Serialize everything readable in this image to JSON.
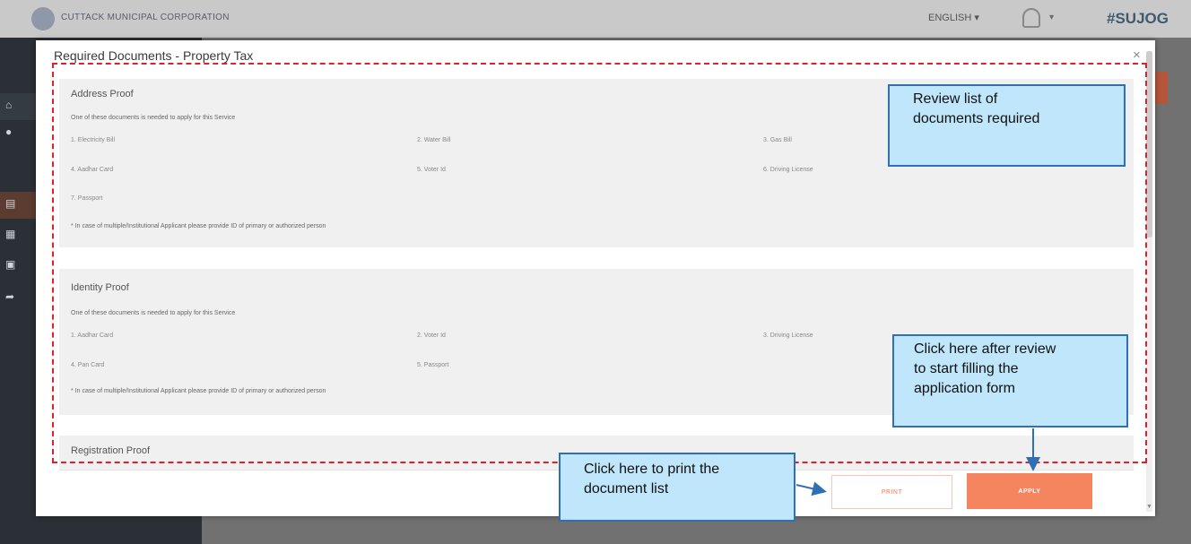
{
  "header": {
    "app_title": "CUTTACK MUNICIPAL CORPORATION",
    "language": "ENGLISH",
    "language_caret": "▾",
    "user_caret": "▾",
    "brand": "#SUJOG"
  },
  "modal": {
    "title": "Required Documents - Property Tax",
    "close_label": "×",
    "sections": [
      {
        "title": "Address Proof",
        "note": "One of these documents is needed to apply for this Service",
        "docs": [
          "1. Electricity Bill",
          "2. Water Bill",
          "3. Gas Bill",
          "4. Aadhar Card",
          "5. Voter Id",
          "6. Driving License",
          "7. Passport"
        ],
        "footnote": "* In case of multiple/Institutional Applicant please provide ID of primary or authorized person"
      },
      {
        "title": "Identity Proof",
        "note": "One of these documents is needed to apply for this Service",
        "docs": [
          "1. Aadhar Card",
          "2. Voter Id",
          "3. Driving License",
          "4. Pan Card",
          "5. Passport"
        ],
        "footnote": "* In case of multiple/Institutional Applicant please provide ID of primary or authorized person"
      },
      {
        "title": "Registration Proof"
      }
    ],
    "print_label": "PRINT",
    "apply_label": "APPLY"
  },
  "annotations": {
    "review": [
      "Review list of",
      "documents required"
    ],
    "apply_hint": [
      "Click here after review",
      "to start filling the",
      "application form"
    ],
    "print_hint": [
      "Click here to print the",
      "document list"
    ]
  },
  "colors": {
    "accent": "#f5855f",
    "annotation_border": "#2f6fb3",
    "annotation_fill": "#bfe6fb",
    "highlight_dash": "#e0202a"
  }
}
